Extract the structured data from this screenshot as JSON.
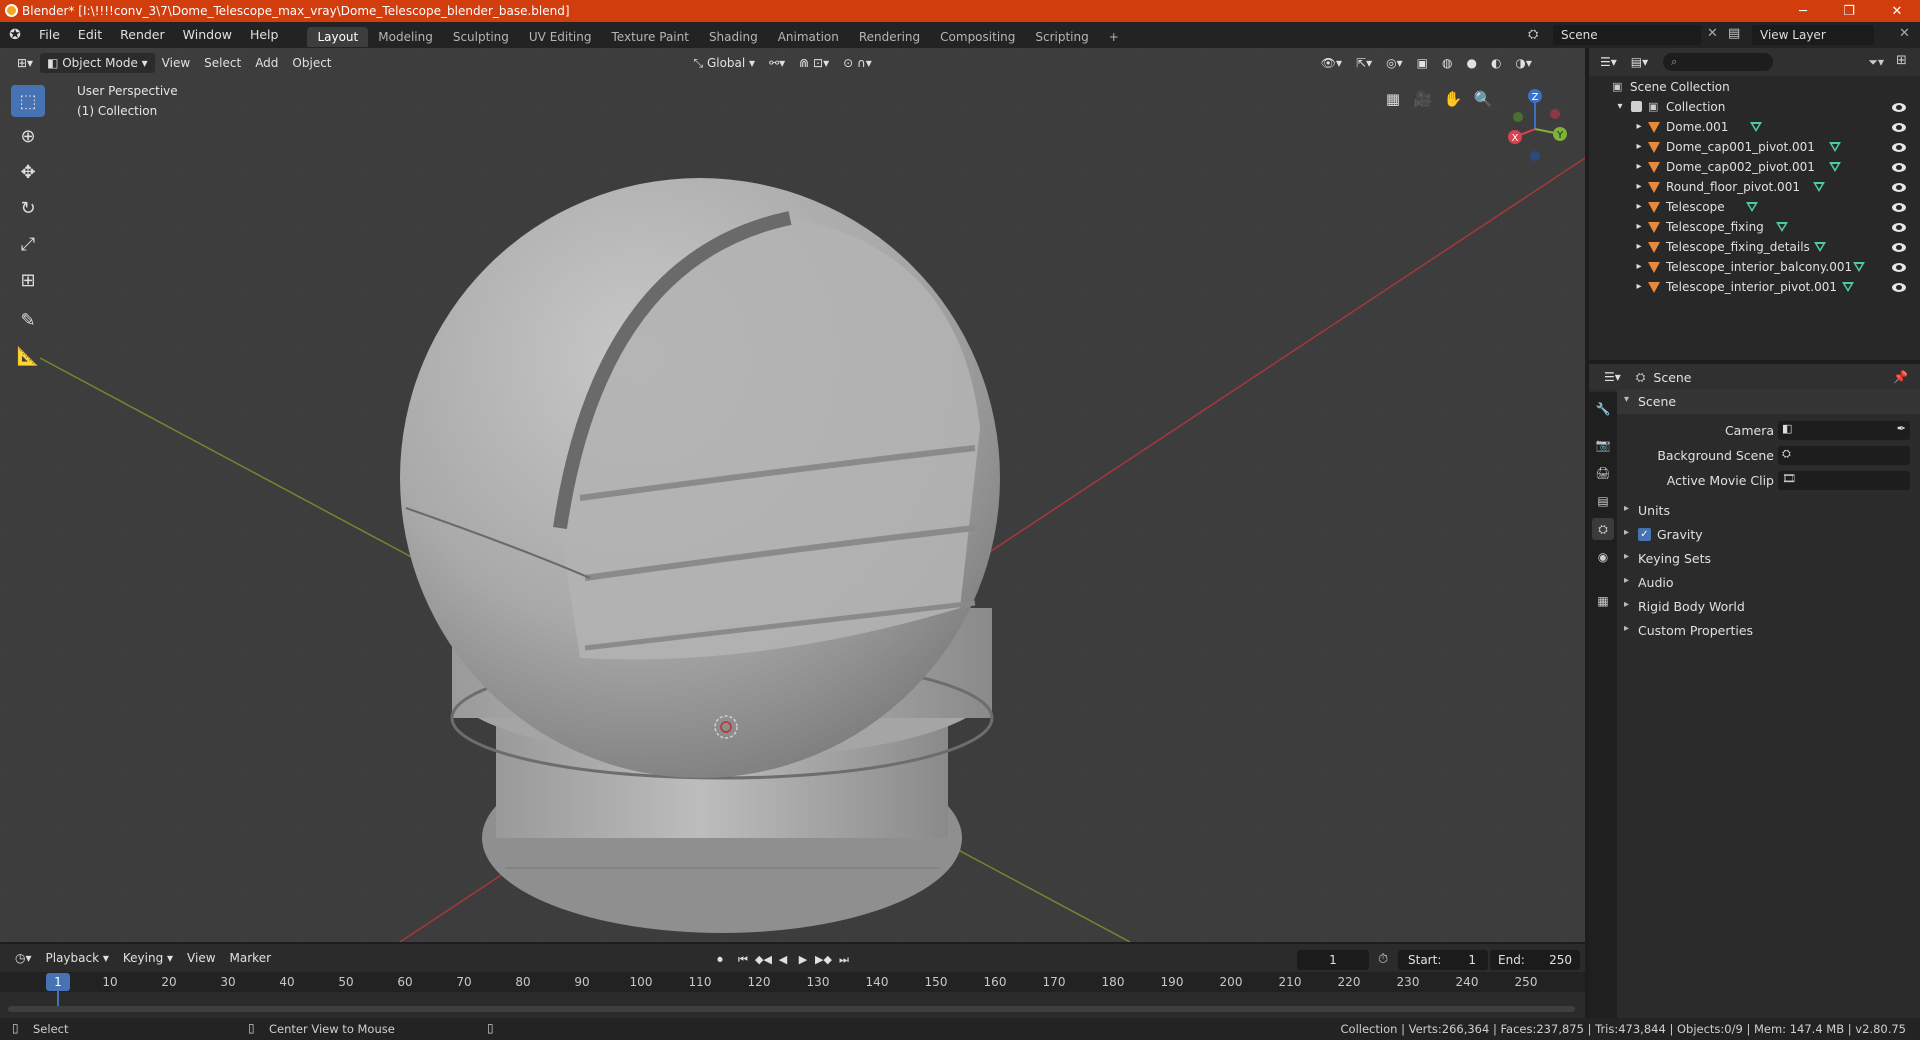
{
  "window": {
    "title": "Blender* [I:\\!!!!conv_3\\7\\Dome_Telescope_max_vray\\Dome_Telescope_blender_base.blend]",
    "minimize": "─",
    "restore": "❐",
    "close": "✕"
  },
  "menu": [
    "File",
    "Edit",
    "Render",
    "Window",
    "Help"
  ],
  "workspaces": [
    "Layout",
    "Modeling",
    "Sculpting",
    "UV Editing",
    "Texture Paint",
    "Shading",
    "Animation",
    "Rendering",
    "Compositing",
    "Scripting"
  ],
  "workspace_add": "+",
  "scene_name": "Scene",
  "view_layer_name": "View Layer",
  "viewport": {
    "mode": "Object Mode",
    "menus": [
      "View",
      "Select",
      "Add",
      "Object"
    ],
    "transform_orientation": "Global",
    "perspective_label": "User Perspective",
    "collection_label": "(1) Collection",
    "gizmo": {
      "x": "X",
      "y": "Y",
      "z": "Z"
    }
  },
  "outliner": {
    "root": "Scene Collection",
    "collection": "Collection",
    "objects": [
      "Dome.001",
      "Dome_cap001_pivot.001",
      "Dome_cap002_pivot.001",
      "Round_floor_pivot.001",
      "Telescope",
      "Telescope_fixing",
      "Telescope_fixing_details",
      "Telescope_interior_balcony.001",
      "Telescope_interior_pivot.001"
    ]
  },
  "properties": {
    "header": "Scene",
    "panel": "Scene",
    "fields": [
      {
        "label": "Camera"
      },
      {
        "label": "Background Scene"
      },
      {
        "label": "Active Movie Clip"
      }
    ],
    "sections": [
      "Units",
      "Gravity",
      "Keying Sets",
      "Audio",
      "Rigid Body World",
      "Custom Properties"
    ],
    "gravity_enabled": true
  },
  "timeline": {
    "menus": [
      "Playback",
      "Keying",
      "View",
      "Marker"
    ],
    "current_frame": "1",
    "start_label": "Start:",
    "start": "1",
    "end_label": "End:",
    "end": "250",
    "ticks": [
      "10",
      "20",
      "30",
      "40",
      "50",
      "60",
      "70",
      "80",
      "90",
      "100",
      "110",
      "120",
      "130",
      "140",
      "150",
      "160",
      "170",
      "180",
      "190",
      "200",
      "210",
      "220",
      "230",
      "240",
      "250"
    ],
    "playhead": "1"
  },
  "status": {
    "left_action": "Select",
    "middle_action": "Center View to Mouse",
    "stats": "Collection | Verts:266,364 | Faces:237,875 | Tris:473,844 | Objects:0/9 | Mem: 147.4 MB | v2.80.75"
  }
}
